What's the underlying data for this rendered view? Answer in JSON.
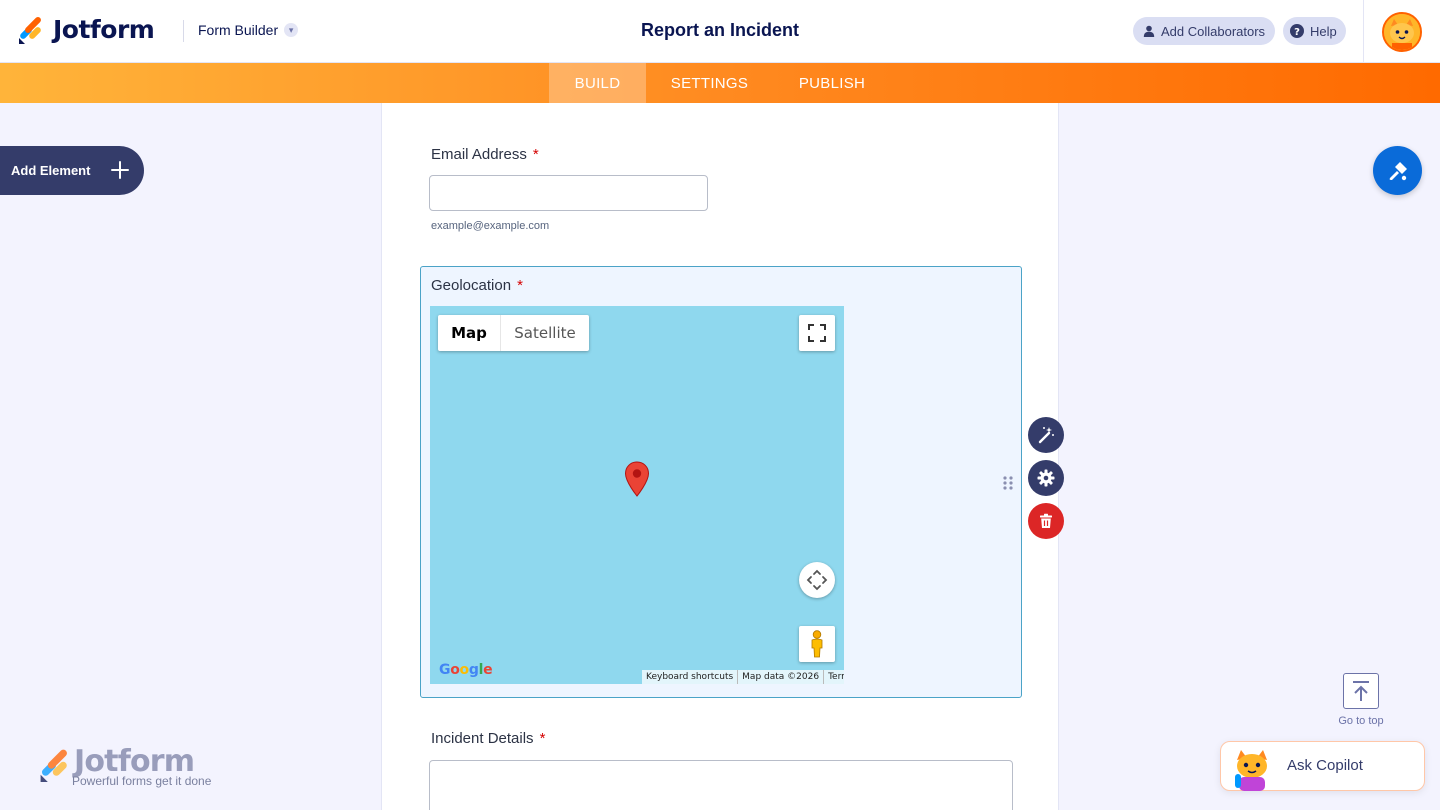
{
  "header": {
    "brand": "Jotform",
    "builder_label": "Form Builder",
    "page_title": "Report an Incident",
    "collaborators_label": "Add Collaborators",
    "help_label": "Help"
  },
  "nav": {
    "tabs": [
      {
        "label": "BUILD",
        "active": true
      },
      {
        "label": "SETTINGS",
        "active": false
      },
      {
        "label": "PUBLISH",
        "active": false
      }
    ]
  },
  "sidebar": {
    "add_element_label": "Add Element"
  },
  "form": {
    "email": {
      "label": "Email Address",
      "required_mark": "*",
      "value": "",
      "sublabel": "example@example.com"
    },
    "geolocation": {
      "label": "Geolocation",
      "required_mark": "*",
      "map": {
        "type_buttons": [
          "Map",
          "Satellite"
        ],
        "selected_type": "Map",
        "footer": [
          "Keyboard shortcuts",
          "Map data ©2026",
          "Terms"
        ],
        "provider": "Google"
      }
    },
    "incident_details": {
      "label": "Incident Details",
      "required_mark": "*",
      "value": ""
    }
  },
  "right_panel": {
    "go_to_top_label": "Go to top",
    "copilot_label": "Ask Copilot"
  },
  "watermark": {
    "brand": "Jotform",
    "tagline": "Powerful forms get it done"
  },
  "colors": {
    "accent_orange": "#ff6100",
    "navy": "#0a1551",
    "theme_blue": "#0a6bd9",
    "danger_red": "#dc2626",
    "map_water": "#8fd8ee"
  }
}
